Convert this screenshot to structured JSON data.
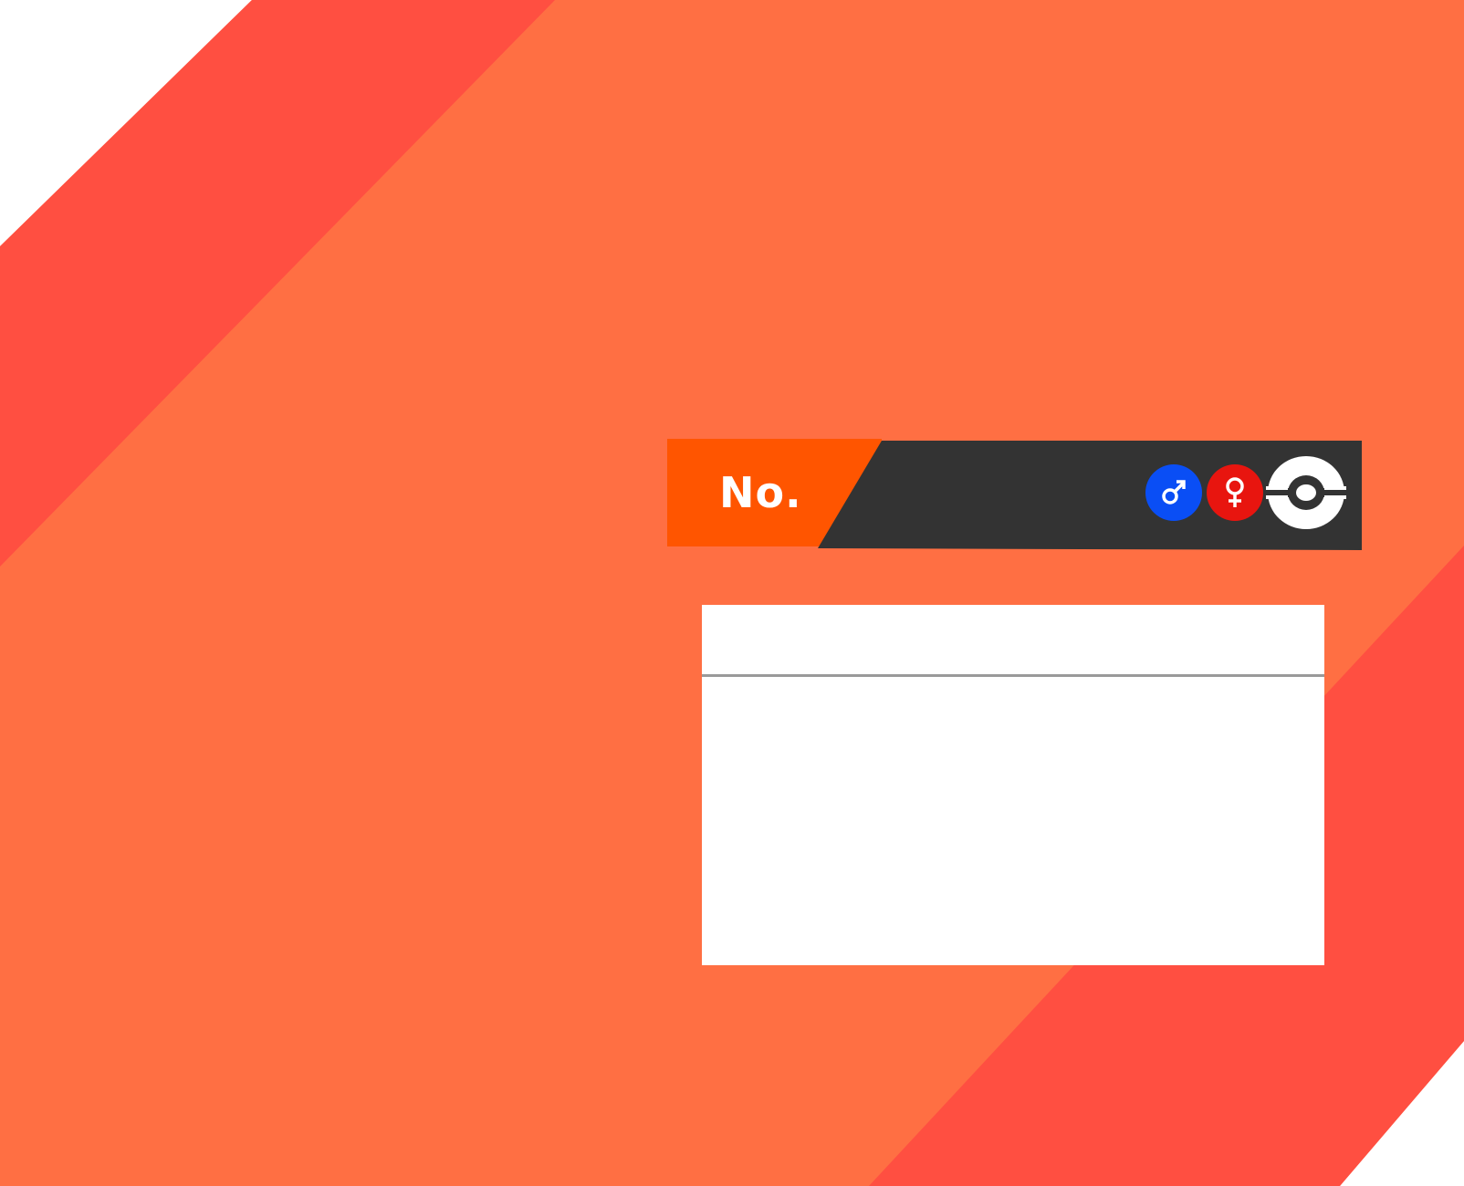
{
  "header": {
    "number_label": "No."
  },
  "filters": {
    "male_icon": "male-symbol",
    "female_icon": "female-symbol",
    "pokeball_icon": "pokeball"
  },
  "info_panel": {
    "title": "",
    "body": ""
  },
  "colors": {
    "background_orange": "#ff6f43",
    "stripe_red": "#ff4f41",
    "number_tab_orange": "#ff5500",
    "header_dark": "#333333",
    "male_blue": "#0a4ef5",
    "female_red": "#e8150f",
    "panel_white": "#ffffff",
    "divider_gray": "#9a9a9a"
  }
}
